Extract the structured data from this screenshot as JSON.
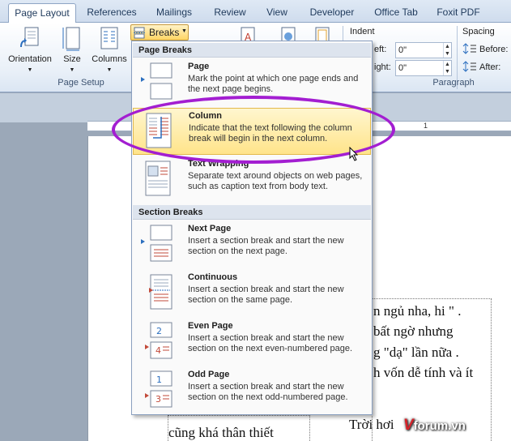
{
  "ribbon_tabs": [
    "Page Layout",
    "References",
    "Mailings",
    "Review",
    "View",
    "Developer",
    "Office Tab",
    "Foxit PDF"
  ],
  "ribbon": {
    "orientation_label": "Orientation",
    "size_label": "Size",
    "columns_label": "Columns",
    "breaks_label": "Breaks",
    "page_setup_label": "Page Setup",
    "indent_label": "Indent",
    "left_label": "eft:",
    "right_label": "ight:",
    "left_value": "0\"",
    "right_value": "0\"",
    "spacing_label": "Spacing",
    "before_label": "Before:",
    "after_label": "After:",
    "paragraph_label": "Paragraph"
  },
  "ruler": {
    "mark": "1"
  },
  "menu": {
    "page_breaks_header": "Page Breaks",
    "section_breaks_header": "Section Breaks",
    "items": [
      {
        "title": "Page",
        "desc": "Mark the point at which one page ends and the next page begins."
      },
      {
        "title": "Column",
        "desc": "Indicate that the text following the column break will begin in the next column."
      },
      {
        "title": "Text Wrapping",
        "desc": "Separate text around objects on web pages, such as caption text from body text."
      },
      {
        "title": "Next Page",
        "desc": "Insert a section break and start the new section on the next page."
      },
      {
        "title": "Continuous",
        "desc": "Insert a section break and start the new section on the same page."
      },
      {
        "title": "Even Page",
        "desc": "Insert a section break and start the new section on the next even-numbered page."
      },
      {
        "title": "Odd Page",
        "desc": "Insert a section break and start the new section on the next odd-numbered page."
      }
    ]
  },
  "document": {
    "right_lines": [
      "n ngủ nha, hi \" .",
      "bất  ngờ  nhưng",
      "g \"dạ\" lần nữa .",
      "h vốn dễ tính và ít"
    ],
    "left_bottom": "cũng  khá  thân  thiết",
    "right_bottom": "Trời  hơi"
  },
  "watermark": {
    "v": "V",
    "rest": "forum.vn"
  },
  "colors": {
    "highlight_ellipse": "#a31ed1",
    "menu_hover": "#ffe48a",
    "ribbon_text": "#1e395b"
  }
}
